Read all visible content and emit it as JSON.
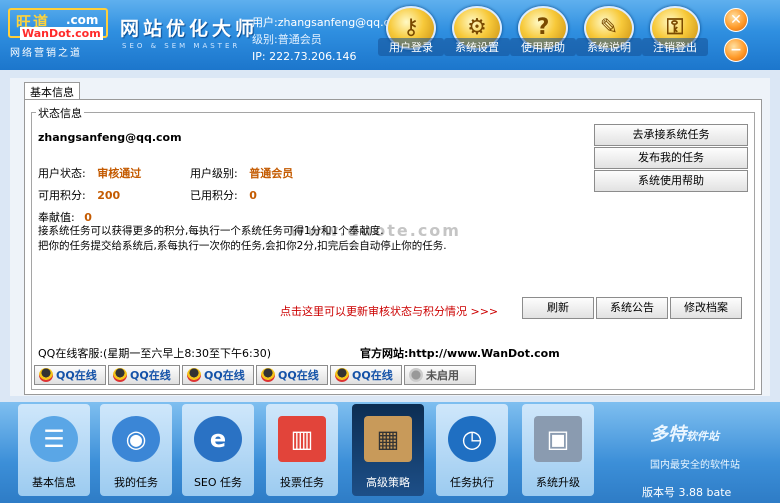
{
  "colors": {
    "accent": "#2f8fe0",
    "highlight": "#c45a00",
    "link_red": "#cc0000"
  },
  "header": {
    "logo_cn": "旺道",
    "logo_com": ".com",
    "logo_domain": "WanDot.com",
    "logo_slogan": "网络营销之道",
    "app_title": "网站优化大师",
    "app_subtitle": "SEO & SEM MASTER",
    "user_line": "用户:zhangsanfeng@qq.com",
    "level_line": "级别:普通会员",
    "ip_line": "IP: 222.73.206.146"
  },
  "toolbar": [
    {
      "label": "用户登录",
      "icon": "key-icon",
      "glyph": "⚷"
    },
    {
      "label": "系统设置",
      "icon": "gear-icon",
      "glyph": "⚙"
    },
    {
      "label": "使用帮助",
      "icon": "help-icon",
      "glyph": "?"
    },
    {
      "label": "系统说明",
      "icon": "document-icon",
      "glyph": "✎"
    },
    {
      "label": "注销登出",
      "icon": "lock-icon",
      "glyph": "⚿"
    }
  ],
  "tab": {
    "label": "基本信息"
  },
  "status": {
    "legend": "状态信息",
    "email": "zhangsanfeng@qq.com",
    "user_state_label": "用户状态:",
    "user_state_value": "审核通过",
    "user_level_label": "用户级别:",
    "user_level_value": "普通会员",
    "available_label": "可用积分:",
    "available_value": "200",
    "used_label": "已用积分:",
    "used_value": "0",
    "contribution_label": "奉献值:",
    "contribution_value": "0",
    "info_line1": "接系统任务可以获得更多的积分,每执行一个系统任务可得1分和1个奉献度.",
    "info_line2": "把你的任务提交给系统后,系每执行一次你的任务,会扣你2分,扣完后会自动停止你的任务.",
    "watermark": "www.duote.com"
  },
  "side_buttons": [
    "去承接系统任务",
    "发布我的任务",
    "系统使用帮助"
  ],
  "refresh_link": "点击这里可以更新审核状态与积分情况  >>>",
  "action_buttons": [
    "刷新",
    "系统公告",
    "修改档案"
  ],
  "qq_service": "QQ在线客服:(星期一至六早上8:30至下午6:30)",
  "official_site_label": "官方网站:",
  "official_site_url": "http://www.WanDot.com",
  "qq_buttons": [
    "QQ在线",
    "QQ在线",
    "QQ在线",
    "QQ在线",
    "QQ在线",
    "未启用"
  ],
  "nav": [
    {
      "label": "基本信息",
      "icon": "user-info-icon",
      "glyph": "☰"
    },
    {
      "label": "我的任务",
      "icon": "globe-icon",
      "glyph": "◉"
    },
    {
      "label": "SEO 任务",
      "icon": "ie-icon",
      "glyph": "e"
    },
    {
      "label": "投票任务",
      "icon": "bar-blocks-icon",
      "glyph": "▥"
    },
    {
      "label": "高级策略",
      "icon": "go-board-icon",
      "glyph": "▦"
    },
    {
      "label": "任务执行",
      "icon": "clock-icon",
      "glyph": "◷"
    },
    {
      "label": "系统升级",
      "icon": "cube-icon",
      "glyph": "▣"
    }
  ],
  "branding": {
    "name": "多特",
    "name_sub": "软件站",
    "tagline": "国内最安全的软件站"
  },
  "version": "版本号  3.88 bate"
}
